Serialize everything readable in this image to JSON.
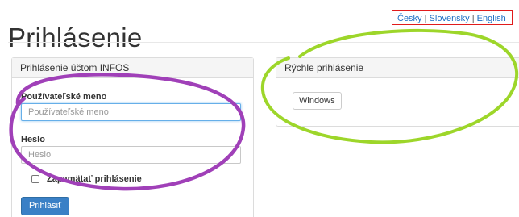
{
  "page": {
    "title": "Prihlásenie"
  },
  "languages": {
    "items": [
      "Česky",
      "Slovensky",
      "English"
    ],
    "separator": "|"
  },
  "login_panel": {
    "heading": "Prihlásenie účtom INFOS",
    "username": {
      "label": "Používateľské meno",
      "placeholder": "Používateľské meno",
      "value": ""
    },
    "password": {
      "label": "Heslo",
      "placeholder": "Heslo",
      "value": ""
    },
    "remember": {
      "label": "Zapamätať prihlásenie",
      "checked": false
    },
    "submit_label": "Prihlásiť"
  },
  "quick_panel": {
    "heading": "Rýchle prihlásenie",
    "windows_button_label": "Windows"
  },
  "annotations": {
    "purple_ellipse_color": "#a040b8",
    "green_ellipse_color": "#9dd62a",
    "language_box_color": "#e11b1b"
  },
  "colors": {
    "primary_button": "#3a80c6",
    "link": "#1d6fc4",
    "focus_border": "#66afe9"
  }
}
